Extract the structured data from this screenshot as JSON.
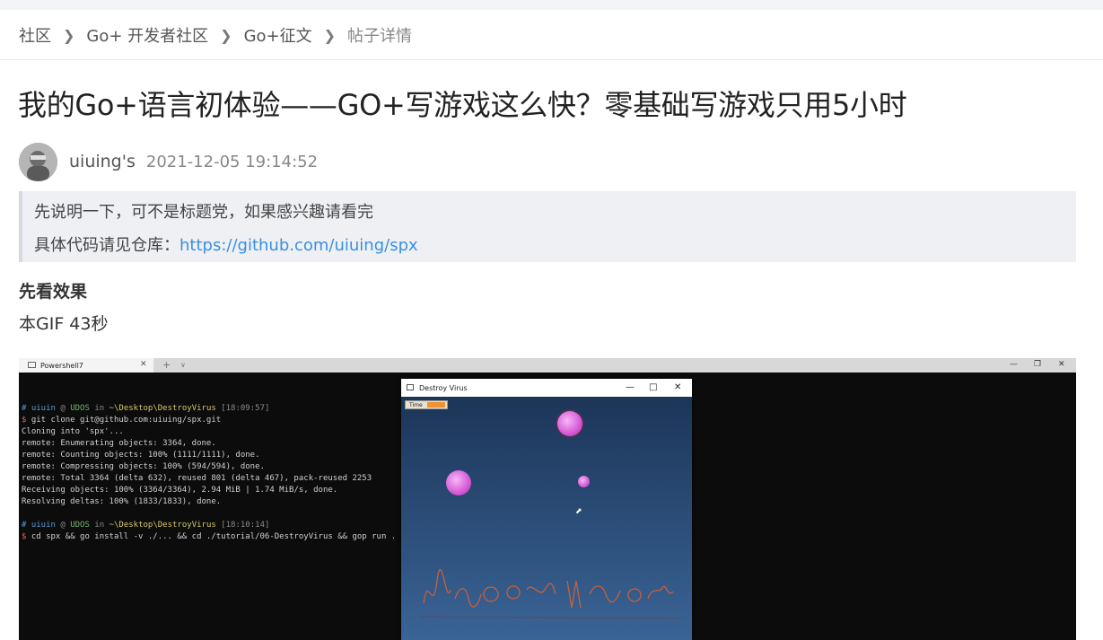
{
  "breadcrumbs": [
    {
      "label": "社区"
    },
    {
      "label": "Go+ 开发者社区"
    },
    {
      "label": "Go+征文"
    },
    {
      "label": "帖子详情"
    }
  ],
  "article": {
    "title": "我的Go+语言初体验——GO+写游戏这么快？零基础写游戏只用5小时",
    "author": "uiuing's",
    "date": "2021-12-05 19:14:52",
    "quote_line1": "先说明一下，可不是标题党，如果感兴趣请看完",
    "quote_line2_prefix": "具体代码请见仓库：",
    "repo_link": "https://github.com/uiuing/spx",
    "section_title": "先看效果",
    "paragraph": "本GIF 43秒"
  },
  "screenshot": {
    "terminal_tab": "Powershell7",
    "terminal_lines": [
      [
        "# uiuin @ UDOS in ~\\Desktop\\DestroyVirus [18:09:57]"
      ],
      [
        "$ git clone git@github.com:uiuing/spx.git"
      ],
      [
        "Cloning into 'spx'..."
      ],
      [
        "remote: Enumerating objects: 3364, done."
      ],
      [
        "remote: Counting objects: 100% (1111/1111), done."
      ],
      [
        "remote: Compressing objects: 100% (594/594), done."
      ],
      [
        "remote: Total 3364 (delta 632), reused 801 (delta 467), pack-reused 2253"
      ],
      [
        "Receiving objects: 100% (3364/3364), 2.94 MiB | 1.74 MiB/s, done."
      ],
      [
        "Resolving deltas: 100% (1833/1833), done."
      ],
      [
        ""
      ],
      [
        "# uiuin @ UDOS in ~\\Desktop\\DestroyVirus [18:10:14]"
      ],
      [
        "$ cd spx && go install -v ./... && cd ./tutorial/06-DestroyVirus && gop run ."
      ]
    ],
    "game_title": "Destroy Virus",
    "time_label": "Time"
  },
  "icons": {
    "chevron": "chevron-right-icon",
    "minimize": "minimize-icon",
    "maximize": "maximize-icon",
    "close": "close-icon"
  },
  "colors": {
    "link": "#3b8fe0",
    "quote_bg": "#eef0f4",
    "terminal_bg": "#0c0c0c",
    "virus": "#d65ad6"
  }
}
